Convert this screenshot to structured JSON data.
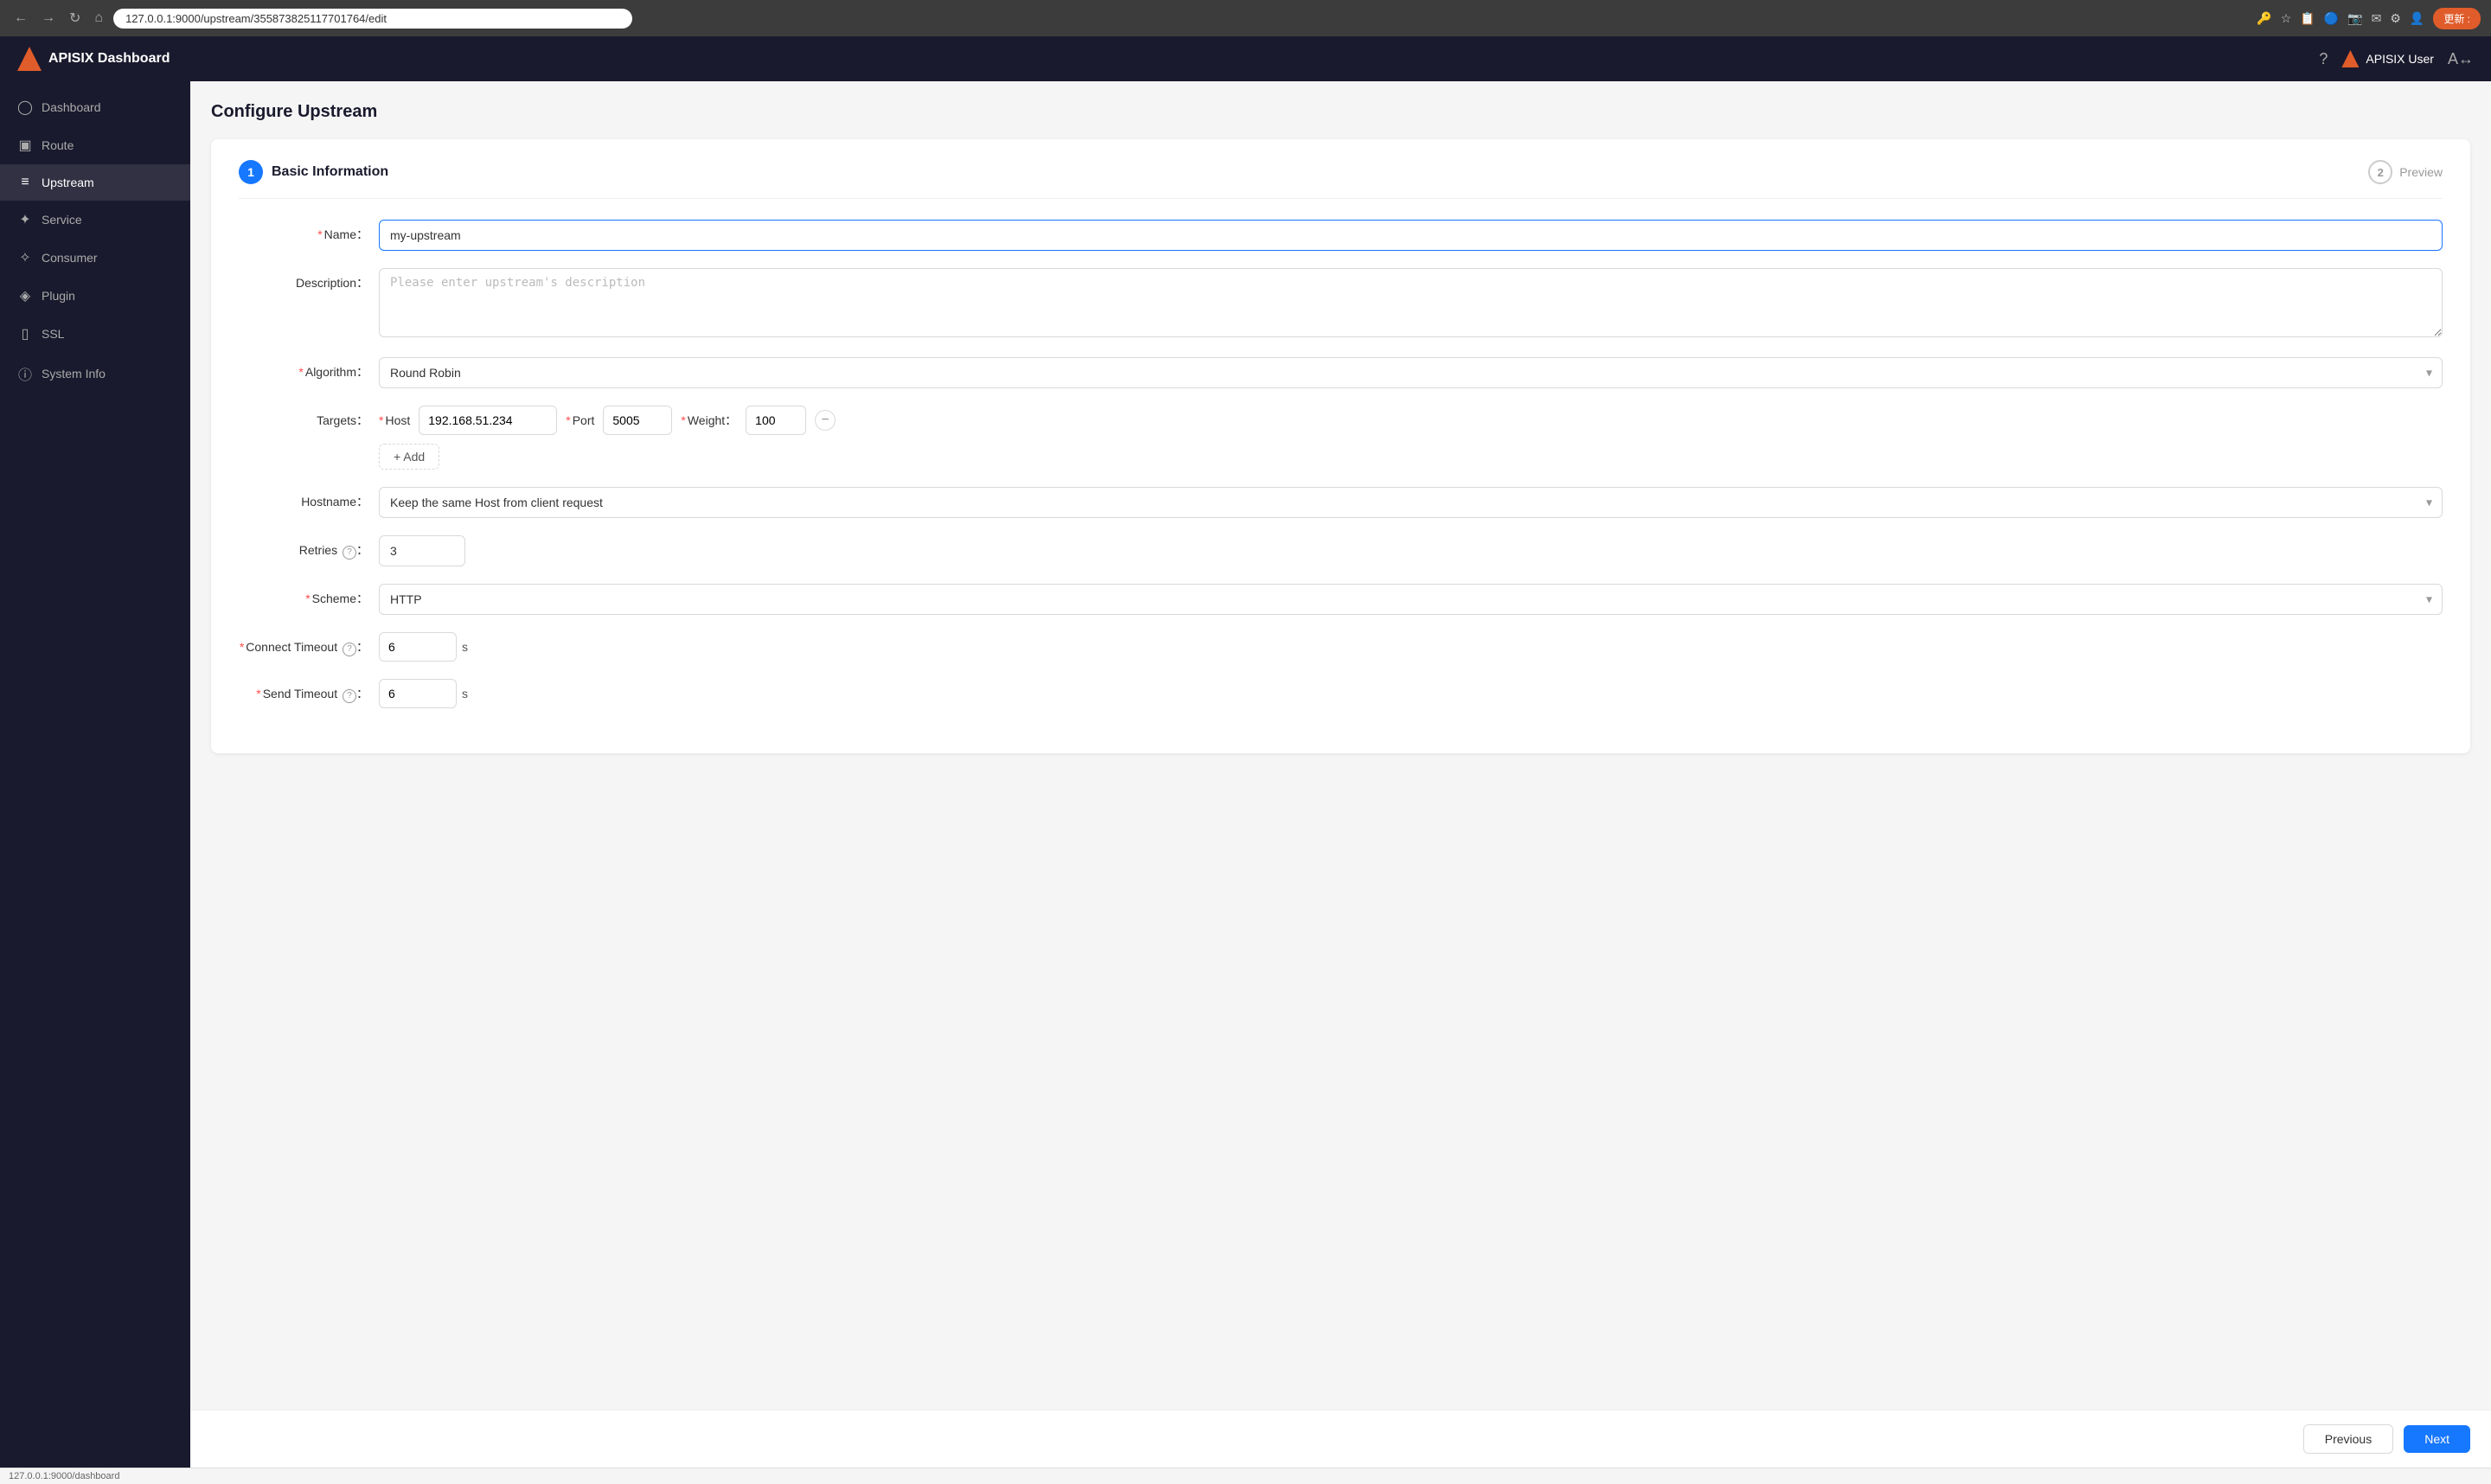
{
  "browser": {
    "url": "127.0.0.1:9000/upstream/355873825117701764/edit",
    "update_label": "更新 :"
  },
  "app": {
    "title": "APISIX Dashboard",
    "user": "APISIX User"
  },
  "sidebar": {
    "items": [
      {
        "id": "dashboard",
        "label": "Dashboard",
        "icon": "⊙"
      },
      {
        "id": "route",
        "label": "Route",
        "icon": "⊞"
      },
      {
        "id": "upstream",
        "label": "Upstream",
        "icon": "≡"
      },
      {
        "id": "service",
        "label": "Service",
        "icon": "✦"
      },
      {
        "id": "consumer",
        "label": "Consumer",
        "icon": "✧"
      },
      {
        "id": "plugin",
        "label": "Plugin",
        "icon": "◈"
      },
      {
        "id": "ssl",
        "label": "SSL",
        "icon": "⊟"
      },
      {
        "id": "system-info",
        "label": "System Info",
        "icon": "ℹ"
      }
    ]
  },
  "page": {
    "title": "Configure Upstream"
  },
  "steps": {
    "step1": {
      "number": "1",
      "label": "Basic Information"
    },
    "step2": {
      "number": "2",
      "label": "Preview"
    }
  },
  "form": {
    "name_label": "Name",
    "name_value": "my-upstream",
    "description_label": "Description",
    "description_placeholder": "Please enter upstream's description",
    "algorithm_label": "Algorithm",
    "algorithm_value": "Round Robin",
    "targets_label": "Targets",
    "host_label": "Host",
    "host_value": "192.168.51.234",
    "port_label": "Port",
    "port_value": "5005",
    "weight_label": "Weight",
    "weight_value": "100",
    "add_label": "+ Add",
    "hostname_label": "Hostname",
    "hostname_value": "Keep the same Host from client request",
    "retries_label": "Retries",
    "retries_value": "3",
    "scheme_label": "Scheme",
    "scheme_value": "HTTP",
    "connect_timeout_label": "Connect Timeout",
    "connect_timeout_value": "6",
    "connect_timeout_suffix": "s",
    "send_timeout_label": "Send Timeout",
    "send_timeout_value": "6",
    "send_timeout_suffix": "s"
  },
  "navigation": {
    "previous_label": "Previous",
    "next_label": "Next"
  },
  "status_bar": {
    "url": "127.0.0.1:9000/dashboard"
  }
}
